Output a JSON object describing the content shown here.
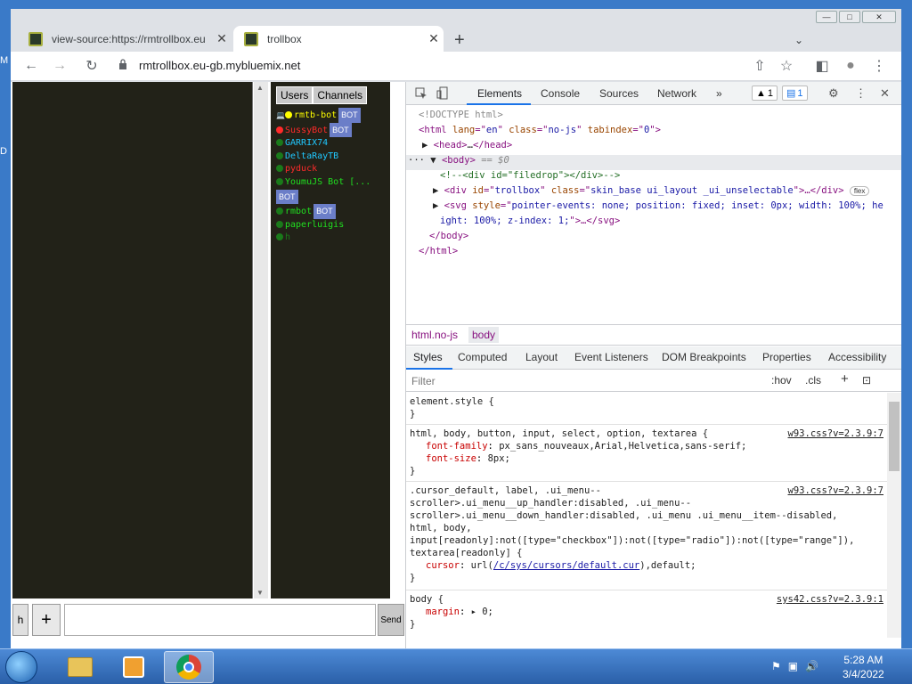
{
  "desktop": {
    "letters": [
      "M",
      "D"
    ]
  },
  "window": {
    "minimize": "—",
    "maximize": "□",
    "close": "✕"
  },
  "tabs": [
    {
      "title": "view-source:https://rmtrollbox.eu",
      "close": "✕"
    },
    {
      "title": "trollbox",
      "close": "✕"
    }
  ],
  "newtab": "+",
  "tabmenu": "⌄",
  "toolbar": {
    "back": "←",
    "forward": "→",
    "reload": "↻",
    "url": "rmtrollbox.eu-gb.mybluemix.net",
    "share": "⇧",
    "star": "☆",
    "panel": "◧",
    "profile": "●",
    "menu": "⋮"
  },
  "trollbox": {
    "tabs": [
      "Users",
      "Channels"
    ],
    "users": [
      {
        "name": "rmtb-bot",
        "color": "#ffff00",
        "bot": "BOT",
        "prefix": "💻"
      },
      {
        "name": "SussyBot",
        "color": "#ff2a2a",
        "bot": "BOT"
      },
      {
        "name": "GARRIX74",
        "color": "#20c8ff"
      },
      {
        "name": "DeltaRayTB",
        "color": "#20c8ff"
      },
      {
        "name": "pyduck",
        "color": "#ff2a2a"
      },
      {
        "name": "YoumuJS Bot [...",
        "color": "#20e020",
        "bot": "BOT"
      },
      {
        "name": "rmbot",
        "color": "#20e020",
        "bot": "BOT"
      },
      {
        "name": "paperluigis",
        "color": "#20e020"
      },
      {
        "name": "h",
        "color": "#20e020"
      }
    ],
    "h_button": "h",
    "plus_button": "+",
    "send_label": "Send",
    "dot_color": "#1a7a1a"
  },
  "devtools": {
    "tabs": [
      "Elements",
      "Console",
      "Sources",
      "Network",
      "»"
    ],
    "warnings": "1",
    "messages": "1",
    "dom": [
      "<!DOCTYPE html>",
      "html",
      "lang",
      "en",
      "class",
      "no-js",
      "tabindex",
      "0",
      "head",
      "…",
      "body",
      "== $0",
      "<!--<div id=\"filedrop\"></div>-->",
      "div",
      "id",
      "trollbox",
      "class",
      "skin_base ui_layout _ui_unselectable",
      "flex",
      "svg",
      "style",
      "pointer-events: none; position: fixed; inset: 0px; width: 100%; he",
      "ight: 100%; z-index: 1;",
      "</body>",
      "</html>"
    ],
    "crumbs": [
      "html.no-js",
      "body"
    ],
    "style_tabs": [
      "Styles",
      "Computed",
      "Layout",
      "Event Listeners",
      "DOM Breakpoints",
      "Properties",
      "Accessibility"
    ],
    "filter_placeholder": "Filter",
    "hov": ":hov",
    "cls": ".cls",
    "rules": [
      {
        "selector": "element.style {",
        "close": "}"
      },
      {
        "selector": "html, body, button, input, select, option, textarea {",
        "source": "w93.css?v=2.3.9:7",
        "props": [
          [
            "font-family",
            "px_sans_nouveaux,Arial,Helvetica,sans-serif;"
          ],
          [
            "font-size",
            "8px;"
          ]
        ],
        "close": "}"
      },
      {
        "selector_lines": [
          ".cursor_default, label, .ui_menu--",
          "scroller>.ui_menu__up_handler:disabled, .ui_menu--",
          "scroller>.ui_menu__down_handler:disabled, .ui_menu .ui_menu__item--disabled,",
          "html, body,",
          "input[readonly]:not([type=\"checkbox\"]):not([type=\"radio\"]):not([type=\"range\"]),",
          "textarea[readonly] {"
        ],
        "source": "w93.css?v=2.3.9:7",
        "props": [
          [
            "cursor",
            "url(",
            "/c/sys/cursors/default.cur",
            "),default;"
          ]
        ],
        "close": "}"
      },
      {
        "selector": "body {",
        "source": "sys42.css?v=2.3.9:1",
        "props": [
          [
            "margin",
            "▸ 0;"
          ]
        ],
        "close": "}"
      }
    ]
  },
  "taskbar": {
    "time": "5:28 AM",
    "date": "3/4/2022"
  }
}
